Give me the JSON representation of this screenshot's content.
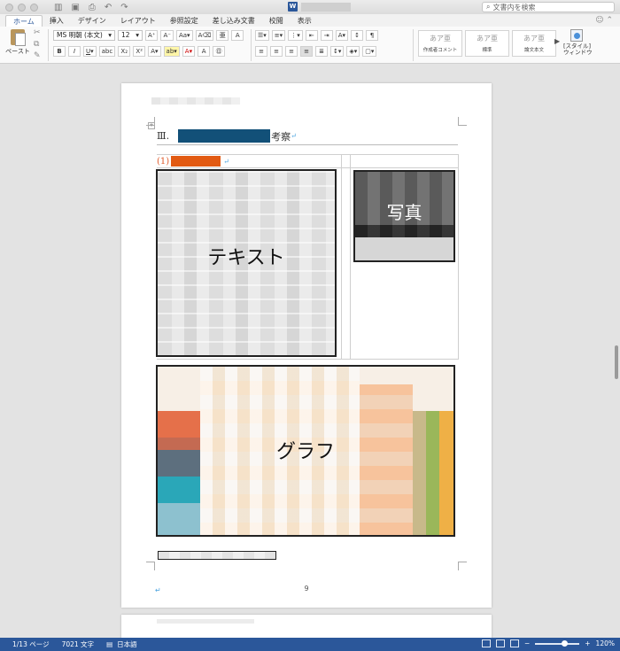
{
  "titlebar": {
    "search_placeholder": "文書内を検索"
  },
  "tabs": [
    "ホーム",
    "挿入",
    "デザイン",
    "レイアウト",
    "参照設定",
    "差し込み文書",
    "校閲",
    "表示"
  ],
  "ribbon": {
    "paste_label": "ペースト",
    "font_name": "MS 明朝 (本文)",
    "font_size": "12",
    "styles": [
      {
        "sample": "あア亜",
        "name": "作成者コメント"
      },
      {
        "sample": "あア亜",
        "name": "標準"
      },
      {
        "sample": "あア亜",
        "name": "論文本文"
      }
    ],
    "style_window_label": "[スタイル]\nウィンドウ"
  },
  "document": {
    "heading_prefix": "Ⅲ.",
    "heading_suffix": "考察",
    "sub_prefix": "(1)",
    "text_label": "テキスト",
    "photo_label": "写真",
    "graph_label": "グラフ",
    "page_number": "9",
    "para_mark": "↵"
  },
  "status": {
    "page": "1/13 ページ",
    "words": "7021 文字",
    "language": "日本語",
    "zoom": "120%"
  },
  "colors": {
    "accent": "#2b579a",
    "heading_redact": "#125078",
    "sub_redact": "#e25a12"
  }
}
